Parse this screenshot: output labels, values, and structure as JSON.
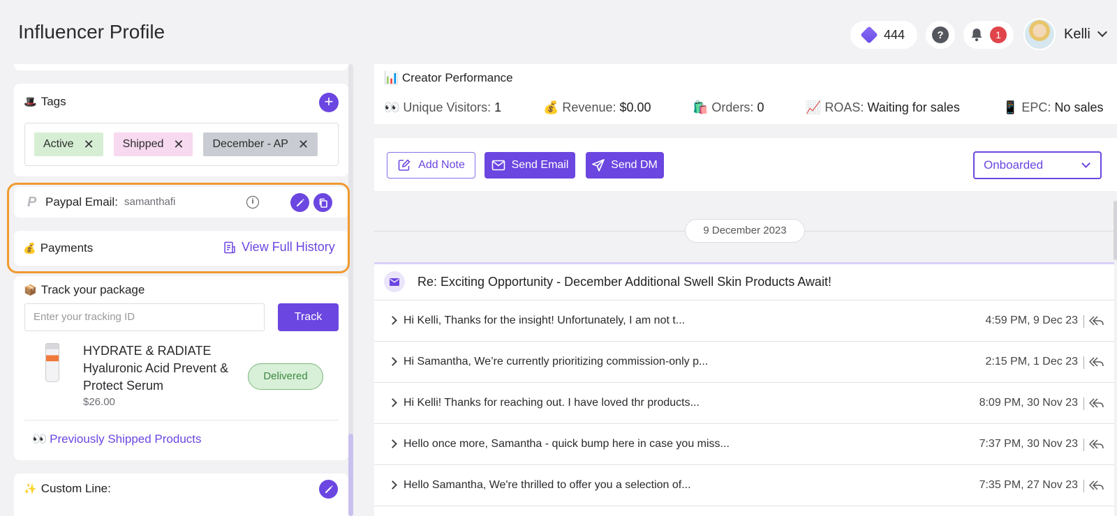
{
  "header": {
    "title": "Influencer Profile",
    "gems_count": "444",
    "help_label": "?",
    "notification_count": "1",
    "user_name": "Kelli"
  },
  "tags": {
    "title": "Tags",
    "emoji": "🎩",
    "items": [
      {
        "label": "Active",
        "color": "#d6efd4"
      },
      {
        "label": "Shipped",
        "color": "#f7d9f0"
      },
      {
        "label": "December - AP",
        "color": "#c9ccd2"
      }
    ]
  },
  "paypal": {
    "label": "Paypal Email:",
    "value": "samanthafi",
    "icon_letter": "P",
    "info_label": "i"
  },
  "payments": {
    "title": "Payments",
    "emoji": "💰",
    "history_label": "View Full History"
  },
  "track": {
    "title": "Track your package",
    "emoji": "📦",
    "placeholder": "Enter your tracking ID",
    "button": "Track",
    "product_name": "HYDRATE & RADIATE Hyaluronic Acid Prevent & Protect Serum",
    "product_price": "$26.00",
    "status": "Delivered",
    "previous_link": "Previously Shipped Products",
    "previous_emoji": "👀"
  },
  "custom_line": {
    "title": "Custom Line:",
    "emoji": "✨"
  },
  "performance": {
    "title": "Creator Performance",
    "emoji": "📊",
    "stats": [
      {
        "emoji": "👀",
        "label": "Unique Visitors:",
        "value": "1"
      },
      {
        "emoji": "💰",
        "label": "Revenue:",
        "value": "$0.00"
      },
      {
        "emoji": "🛍️",
        "label": "Orders:",
        "value": "0"
      },
      {
        "emoji": "📈",
        "label": "ROAS:",
        "value": "Waiting for sales"
      },
      {
        "emoji": "📱",
        "label": "EPC:",
        "value": "No sales"
      }
    ]
  },
  "actions": {
    "add_note": "Add Note",
    "send_email": "Send Email",
    "send_dm": "Send DM",
    "status_selected": "Onboarded"
  },
  "conversation": {
    "date": "9 December 2023",
    "subject": "Re: Exciting Opportunity - December Additional Swell Skin Products Await!",
    "messages": [
      {
        "text": "Hi Kelli, Thanks for the insight! Unfortunately, I am not t...",
        "time": "4:59 PM, 9 Dec 23"
      },
      {
        "text": "Hi Samantha, We’re currently prioritizing commission-only p...",
        "time": "2:15 PM, 1 Dec 23"
      },
      {
        "text": "Hi Kelli! Thanks for reaching out. I have loved thr products...",
        "time": "8:09 PM, 30 Nov 23"
      },
      {
        "text": "Hello once more, Samantha - quick bump here in case you miss...",
        "time": "7:37 PM, 30 Nov 23"
      },
      {
        "text": "Hello Samantha, We're thrilled to offer you a selection of...",
        "time": "7:35 PM, 27 Nov 23"
      }
    ]
  },
  "colors": {
    "accent": "#6b46e0",
    "highlight": "#f09a2e",
    "delivered": "#3d8a40"
  }
}
